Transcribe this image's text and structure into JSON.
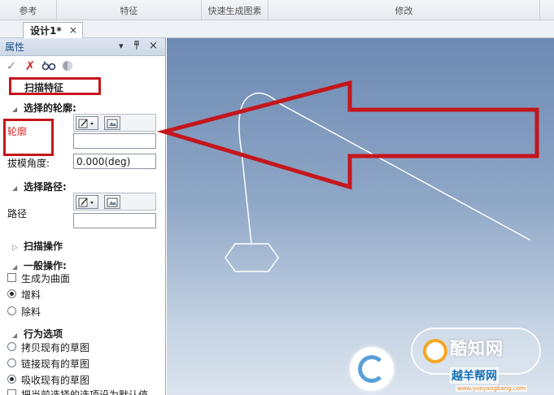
{
  "ribbon": {
    "groups": [
      "参考",
      "特征",
      "快速生成图素",
      "修改"
    ]
  },
  "document_tab": {
    "label": "设计1*",
    "close": "×"
  },
  "panel": {
    "title": "属性",
    "pin": "▾",
    "dock": "ᵖ",
    "close": "×",
    "toolbar": {
      "ok": "✓",
      "cancel": "✗",
      "preview": "6ෆ",
      "help": "●"
    },
    "header": "扫描特征",
    "profile_section": "选择的轮廓:",
    "profile_label": "轮廓",
    "profile_value": "",
    "draft_angle_label": "拔模角度:",
    "draft_angle_value": "0.000(deg)",
    "path_section": "选择路径:",
    "path_label": "路径",
    "path_value": "",
    "sweep_ops": "扫描操作",
    "general_ops": "一般操作:",
    "as_surface": "生成为曲面",
    "op_add": "增料",
    "op_remove": "除料",
    "behavior": "行为选项",
    "copy_sketch": "拷贝现有的草图",
    "link_sketch": "链接现有的草图",
    "absorb_sketch": "吸收现有的草图",
    "last_row": "把当前选择的选项设为默认值"
  },
  "watermark": {
    "site_name": "酷知网",
    "site2_name": "越羊帮网",
    "site2_url": "www.yueyangbang.com"
  },
  "colors": {
    "annotation_red": "#c4161c",
    "curve_white": "#ffffff",
    "viewport_top": "#6e8ab3",
    "viewport_bottom": "#dbe4ee"
  }
}
